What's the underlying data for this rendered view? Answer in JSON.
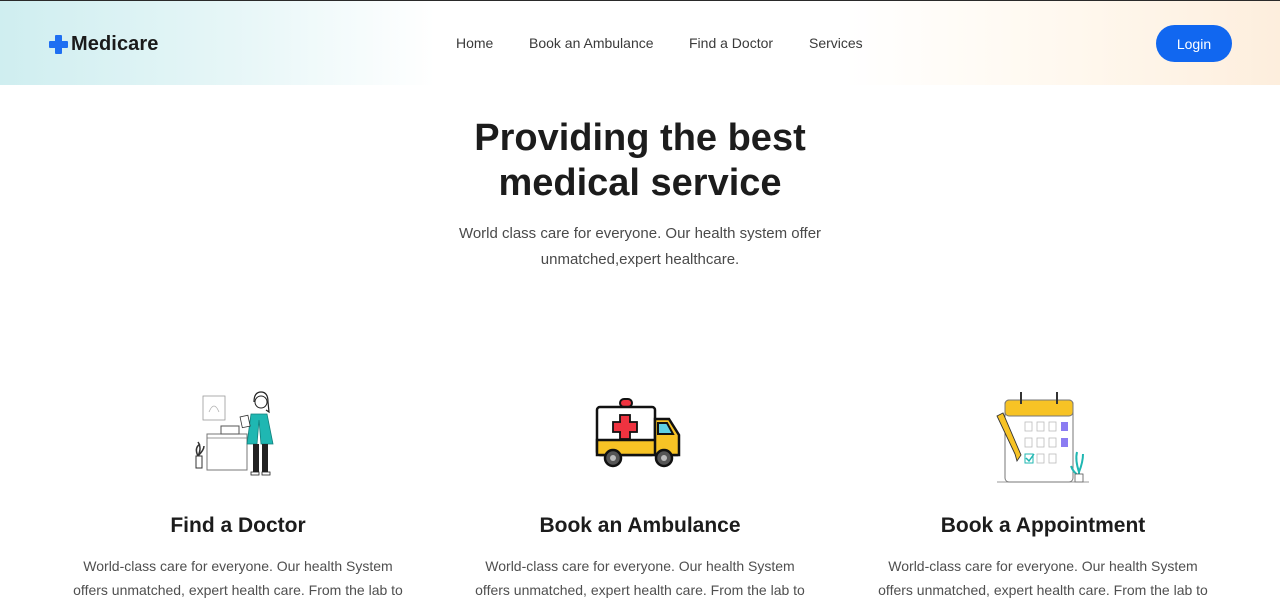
{
  "header": {
    "brand": "Medicare",
    "nav": [
      "Home",
      "Book an Ambulance",
      "Find a Doctor",
      "Services"
    ],
    "login_label": "Login"
  },
  "hero": {
    "title_line1": "Providing the best",
    "title_line2": "medical service",
    "subtitle_line1": "World class care for everyone. Our health system offer",
    "subtitle_line2": "unmatched,expert healthcare."
  },
  "cards": [
    {
      "icon": "doctor-illustration",
      "title": "Find a Doctor",
      "desc_line1": "World-class care for everyone. Our health System",
      "desc_line2": "offers unmatched, expert health care. From the lab to"
    },
    {
      "icon": "ambulance-illustration",
      "title": "Book an Ambulance",
      "desc_line1": "World-class care for everyone. Our health System",
      "desc_line2": "offers unmatched, expert health care. From the lab to"
    },
    {
      "icon": "calendar-illustration",
      "title": "Book a Appointment",
      "desc_line1": "World-class care for everyone. Our health System",
      "desc_line2": "offers unmatched, expert health care. From the lab to"
    }
  ],
  "colors": {
    "accent": "#1167f0",
    "ambulance_yellow": "#f7c325",
    "teal": "#1fb7b2",
    "purple": "#8b7cf2",
    "cross_red": "#ef3340"
  }
}
